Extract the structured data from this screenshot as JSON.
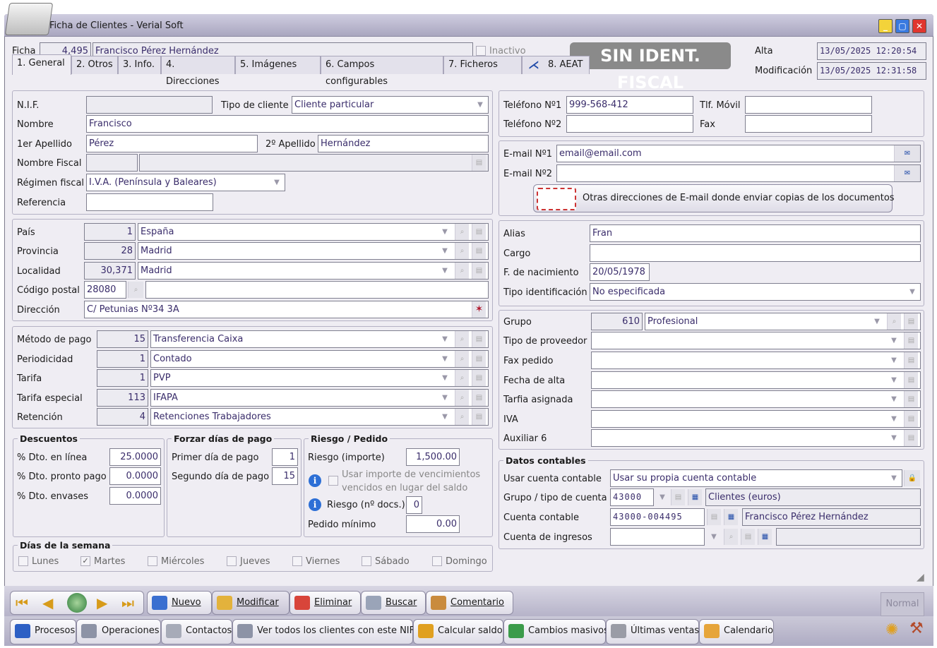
{
  "window": {
    "title": "Ficha de Clientes - Verial Soft"
  },
  "header": {
    "ficha_label": "Ficha",
    "ficha_number": "4,495",
    "ficha_name": "Francisco Pérez Hernández",
    "inactive_label": "Inactivo",
    "badge": "SIN IDENT. FISCAL",
    "alta_label": "Alta",
    "alta_value": "13/05/2025  12:20:54",
    "mod_label": "Modificación",
    "mod_value": "13/05/2025  12:31:58"
  },
  "tabs": [
    {
      "label": "1. General"
    },
    {
      "label": "2. Otros"
    },
    {
      "label": "3. Info."
    },
    {
      "label": "4. Direcciones"
    },
    {
      "label": "5. Imágenes"
    },
    {
      "label": "6. Campos configurables"
    },
    {
      "label": "7. Ficheros"
    },
    {
      "label": "8. AEAT"
    }
  ],
  "ident": {
    "nif_label": "N.I.F.",
    "nif_value": "",
    "tipo_label": "Tipo de cliente",
    "tipo_value": "Cliente particular",
    "nombre_label": "Nombre",
    "nombre_value": "Francisco",
    "ape1_label": "1er Apellido",
    "ape1_value": "Pérez",
    "ape2_label": "2º Apellido",
    "ape2_value": "Hernández",
    "nfiscal_label": "Nombre Fiscal",
    "regimen_label": "Régimen fiscal",
    "regimen_value": "I.V.A. (Península y Baleares)",
    "ref_label": "Referencia"
  },
  "address": {
    "pais_label": "País",
    "pais_code": "1",
    "pais_value": "España",
    "prov_label": "Provincia",
    "prov_code": "28",
    "prov_value": "Madrid",
    "loc_label": "Localidad",
    "loc_code": "30,371",
    "loc_value": "Madrid",
    "cp_label": "Código postal",
    "cp_value": "28080",
    "dir_label": "Dirección",
    "dir_value": "C/ Petunias Nº34 3A"
  },
  "payment": {
    "metodo_label": "Método de pago",
    "metodo_code": "15",
    "metodo_value": "Transferencia Caixa",
    "period_label": "Periodicidad",
    "period_code": "1",
    "period_value": "Contado",
    "tarifa_label": "Tarifa",
    "tarifa_code": "1",
    "tarifa_value": "PVP",
    "tesp_label": "Tarifa especial",
    "tesp_code": "113",
    "tesp_value": "IFAPA",
    "ret_label": "Retención",
    "ret_code": "4",
    "ret_value": "Retenciones Trabajadores"
  },
  "descuentos": {
    "title": "Descuentos",
    "linea_label": "% Dto. en línea",
    "linea_value": "25.0000",
    "pronto_label": "% Dto. pronto pago",
    "pronto_value": "0.0000",
    "envases_label": "% Dto. envases",
    "envases_value": "0.0000"
  },
  "forzar": {
    "title": "Forzar días de pago",
    "primer_label": "Primer día de pago",
    "primer_value": "1",
    "segundo_label": "Segundo día de pago",
    "segundo_value": "15"
  },
  "riesgo": {
    "title": "Riesgo / Pedido",
    "importe_label": "Riesgo (importe)",
    "importe_value": "1,500.00",
    "usar_label_1": "Usar importe de vencimientos",
    "usar_label_2": "vencidos en lugar del saldo",
    "docs_label": "Riesgo (nº docs.)",
    "docs_value": "0",
    "pedido_label": "Pedido mínimo",
    "pedido_value": "0.00"
  },
  "dias": {
    "title": "Días de la semana",
    "items": [
      {
        "label": "Lunes",
        "checked": false
      },
      {
        "label": "Martes",
        "checked": true
      },
      {
        "label": "Miércoles",
        "checked": false
      },
      {
        "label": "Jueves",
        "checked": false
      },
      {
        "label": "Viernes",
        "checked": false
      },
      {
        "label": "Sábado",
        "checked": false
      },
      {
        "label": "Domingo",
        "checked": false
      }
    ]
  },
  "contact": {
    "tel1_label": "Teléfono Nº1",
    "tel1_value": "999-568-412",
    "tel2_label": "Teléfono Nº2",
    "tel2_value": "",
    "movil_label": "Tlf. Móvil",
    "fax_label": "Fax",
    "email1_label": "E-mail Nº1",
    "email1_value": "email@email.com",
    "email2_label": "E-mail Nº2",
    "otras_label": "Otras direcciones de E-mail donde enviar copias de los documentos"
  },
  "personal": {
    "alias_label": "Alias",
    "alias_value": "Fran",
    "cargo_label": "Cargo",
    "nac_label": "F. de nacimiento",
    "nac_value": "20/05/1978",
    "tid_label": "Tipo identificación",
    "tid_value": "No especificada"
  },
  "grupo": {
    "grupo_label": "Grupo",
    "grupo_code": "610",
    "grupo_value": "Profesional",
    "rows": [
      "Tipo de proveedor",
      "Fax pedido",
      "Fecha de alta",
      "Tarfia asignada",
      "IVA",
      "Auxiliar 6"
    ]
  },
  "contables": {
    "title": "Datos contables",
    "usar_label": "Usar cuenta contable",
    "usar_value": "Usar su propia cuenta contable",
    "grupo_label": "Grupo / tipo de cuenta",
    "grupo_code": "43000",
    "grupo_value": "Clientes (euros)",
    "cuenta_label": "Cuenta contable",
    "cuenta_code": "43000-004495",
    "cuenta_value": "Francisco Pérez Hernández",
    "ingresos_label": "Cuenta de ingresos"
  },
  "toolbar": {
    "nuevo": "Nuevo",
    "modificar": "Modificar",
    "eliminar": "Eliminar",
    "buscar": "Buscar",
    "comentario": "Comentario",
    "normal": "Normal"
  },
  "bottombar": {
    "procesos": "Procesos",
    "operaciones": "Operaciones",
    "contactos": "Contactos",
    "ver_nif": "Ver todos los clientes con este NIF",
    "calcular": "Calcular saldo",
    "cambios": "Cambios masivos",
    "ultimas": "Últimas ventas",
    "calendario": "Calendario"
  },
  "colors": {
    "accent": "#3a2d6b",
    "badge": "#8a8a8a",
    "window_bg": "#efedf3"
  }
}
